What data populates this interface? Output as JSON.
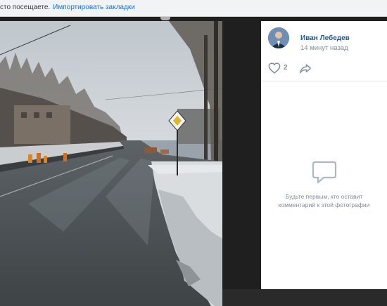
{
  "bookmarks_bar": {
    "prefix": "сто посещаете.",
    "import_link": "Импортировать закладки"
  },
  "post": {
    "author_name": "Иван Лебедев",
    "time": "14 минут назад",
    "like_count": "2"
  },
  "comments": {
    "empty_line1": "Будьте первым, кто оставит",
    "empty_line2": "комментарий к этой фотографии"
  }
}
